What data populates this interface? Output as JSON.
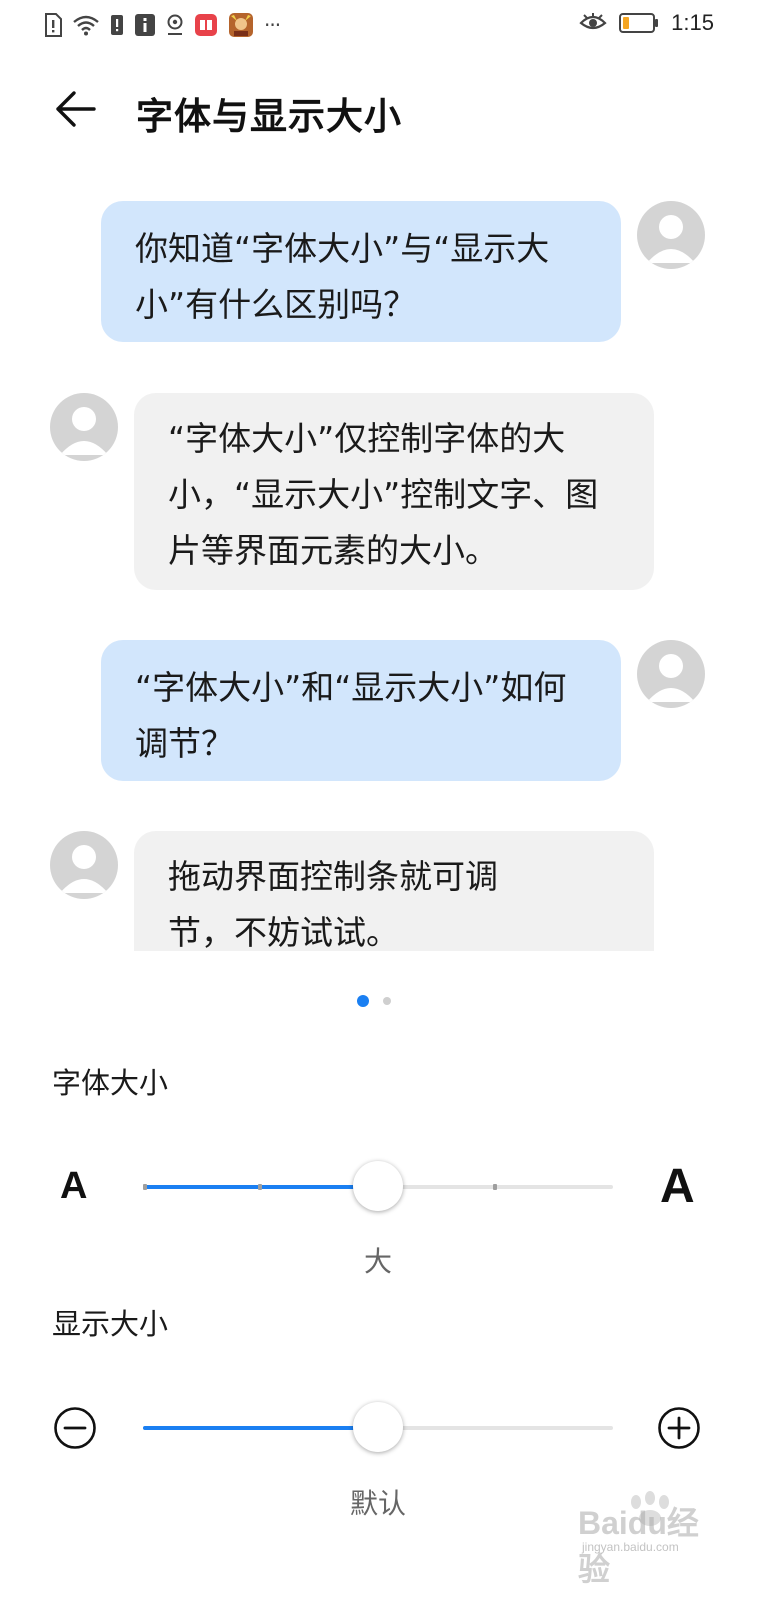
{
  "status_bar": {
    "time": "1:15",
    "left_icons": [
      "sim-alert-icon",
      "wifi-icon",
      "notification-icon",
      "info-icon",
      "location-icon",
      "reader-app-icon",
      "game-app-icon",
      "more-icon"
    ],
    "right_icons": [
      "eye-comfort-icon",
      "battery-icon"
    ],
    "battery_level": 0.2,
    "battery_color": "#f5a623",
    "more_label": "···"
  },
  "app_bar": {
    "title": "字体与显示大小"
  },
  "chat": {
    "messages": [
      {
        "side": "out",
        "text": "你知道“字体大小”与“显示大小”有什么区别吗？"
      },
      {
        "side": "in",
        "text": "“字体大小”仅控制字体的大小，“显示大小”控制文字、图片等界面元素的大小。"
      },
      {
        "side": "out",
        "text": "“字体大小”和“显示大小”如何调节？"
      },
      {
        "side": "in",
        "text": "拖动界面控制条就可调节，不妨试试。"
      }
    ],
    "out_bubble_color": "#d2e6fc",
    "in_bubble_color": "#f1f1f1"
  },
  "pager": {
    "pages": 2,
    "current": 1
  },
  "font_size": {
    "label": "字体大小",
    "small_letter": "A",
    "large_letter": "A",
    "value_label": "大",
    "level": 0.5,
    "steps": 5
  },
  "display_size": {
    "label": "显示大小",
    "value_label": "默认",
    "level": 0.5,
    "decrease_icon": "minus-circle-icon",
    "increase_icon": "plus-circle-icon"
  },
  "accent_color": "#1a7ff2",
  "watermark": {
    "brand": "Baidu经验",
    "sub": "jingyan.baidu.com"
  }
}
